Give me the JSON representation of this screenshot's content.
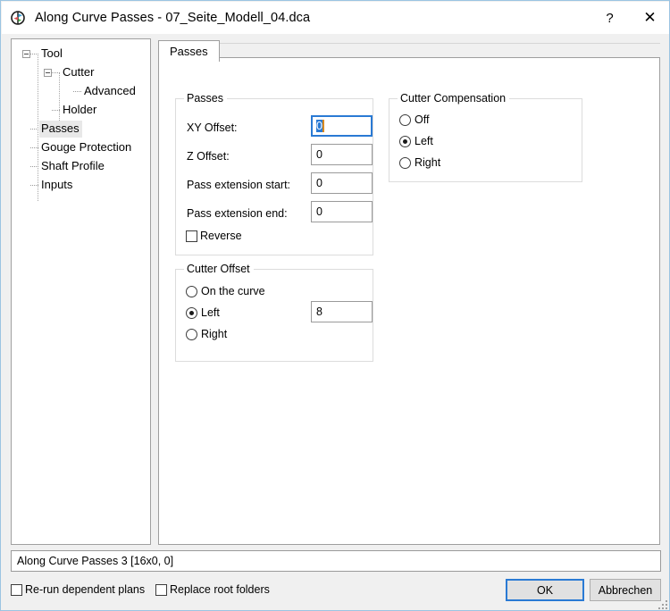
{
  "window": {
    "title": "Along Curve Passes - 07_Seite_Modell_04.dca",
    "icon": "app-icon",
    "help_label": "?",
    "close_label": "✕"
  },
  "tree": {
    "items": [
      {
        "label": "Tool",
        "level": 0,
        "expander": "collapse",
        "selected": false
      },
      {
        "label": "Cutter",
        "level": 1,
        "expander": "collapse",
        "selected": false
      },
      {
        "label": "Advanced",
        "level": 2,
        "expander": "none",
        "selected": false
      },
      {
        "label": "Holder",
        "level": 1,
        "expander": "none",
        "selected": false
      },
      {
        "label": "Passes",
        "level": 0,
        "expander": "none",
        "selected": true
      },
      {
        "label": "Gouge Protection",
        "level": 0,
        "expander": "none",
        "selected": false
      },
      {
        "label": "Shaft Profile",
        "level": 0,
        "expander": "none",
        "selected": false
      },
      {
        "label": "Inputs",
        "level": 0,
        "expander": "none",
        "selected": false
      }
    ]
  },
  "tabs": [
    {
      "label": "Passes",
      "active": true
    }
  ],
  "passes_group": {
    "title": "Passes",
    "fields": [
      {
        "label": "XY Offset:",
        "value": "0",
        "focused": true,
        "selected": true
      },
      {
        "label": "Z Offset:",
        "value": "0",
        "focused": false,
        "selected": false
      },
      {
        "label": "Pass extension start:",
        "value": "0",
        "focused": false,
        "selected": false
      },
      {
        "label": "Pass extension end:",
        "value": "0",
        "focused": false,
        "selected": false
      }
    ],
    "reverse": {
      "label": "Reverse",
      "checked": false
    }
  },
  "cutter_compensation": {
    "title": "Cutter Compensation",
    "options": [
      {
        "label": "Off",
        "checked": false
      },
      {
        "label": "Left",
        "checked": true
      },
      {
        "label": "Right",
        "checked": false
      }
    ]
  },
  "cutter_offset": {
    "title": "Cutter Offset",
    "options": [
      {
        "label": "On the curve",
        "checked": false
      },
      {
        "label": "Left",
        "checked": true
      },
      {
        "label": "Right",
        "checked": false
      }
    ],
    "value": "8"
  },
  "status": {
    "text": "Along Curve Passes 3 [16x0, 0]"
  },
  "bottom": {
    "rerun": {
      "label": "Re-run dependent plans",
      "checked": false
    },
    "replace": {
      "label": "Replace root folders",
      "checked": false
    },
    "ok_label": "OK",
    "cancel_label": "Abbrechen"
  }
}
